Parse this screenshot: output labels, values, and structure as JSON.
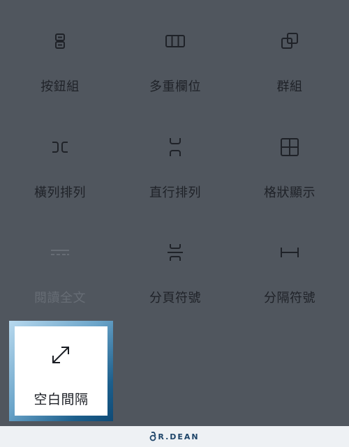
{
  "blocks": [
    {
      "label": "按鈕組",
      "icon": "buttons-icon",
      "disabled": false
    },
    {
      "label": "多重欄位",
      "icon": "columns-icon",
      "disabled": false
    },
    {
      "label": "群組",
      "icon": "group-icon",
      "disabled": false
    },
    {
      "label": "橫列排列",
      "icon": "row-icon",
      "disabled": false
    },
    {
      "label": "直行排列",
      "icon": "stack-icon",
      "disabled": false
    },
    {
      "label": "格狀顯示",
      "icon": "grid-icon",
      "disabled": false
    },
    {
      "label": "閱讀全文",
      "icon": "more-icon",
      "disabled": true
    },
    {
      "label": "分頁符號",
      "icon": "page-break-icon",
      "disabled": false
    },
    {
      "label": "分隔符號",
      "icon": "separator-icon",
      "disabled": false
    }
  ],
  "highlighted": {
    "label": "空白間隔",
    "icon": "spacer-icon"
  },
  "footer": {
    "brand": "R.DEAN",
    "brand_color": "#1e4569"
  },
  "colors": {
    "background": "#50565e",
    "icon": "#1f2228",
    "disabled": "#676d75"
  }
}
